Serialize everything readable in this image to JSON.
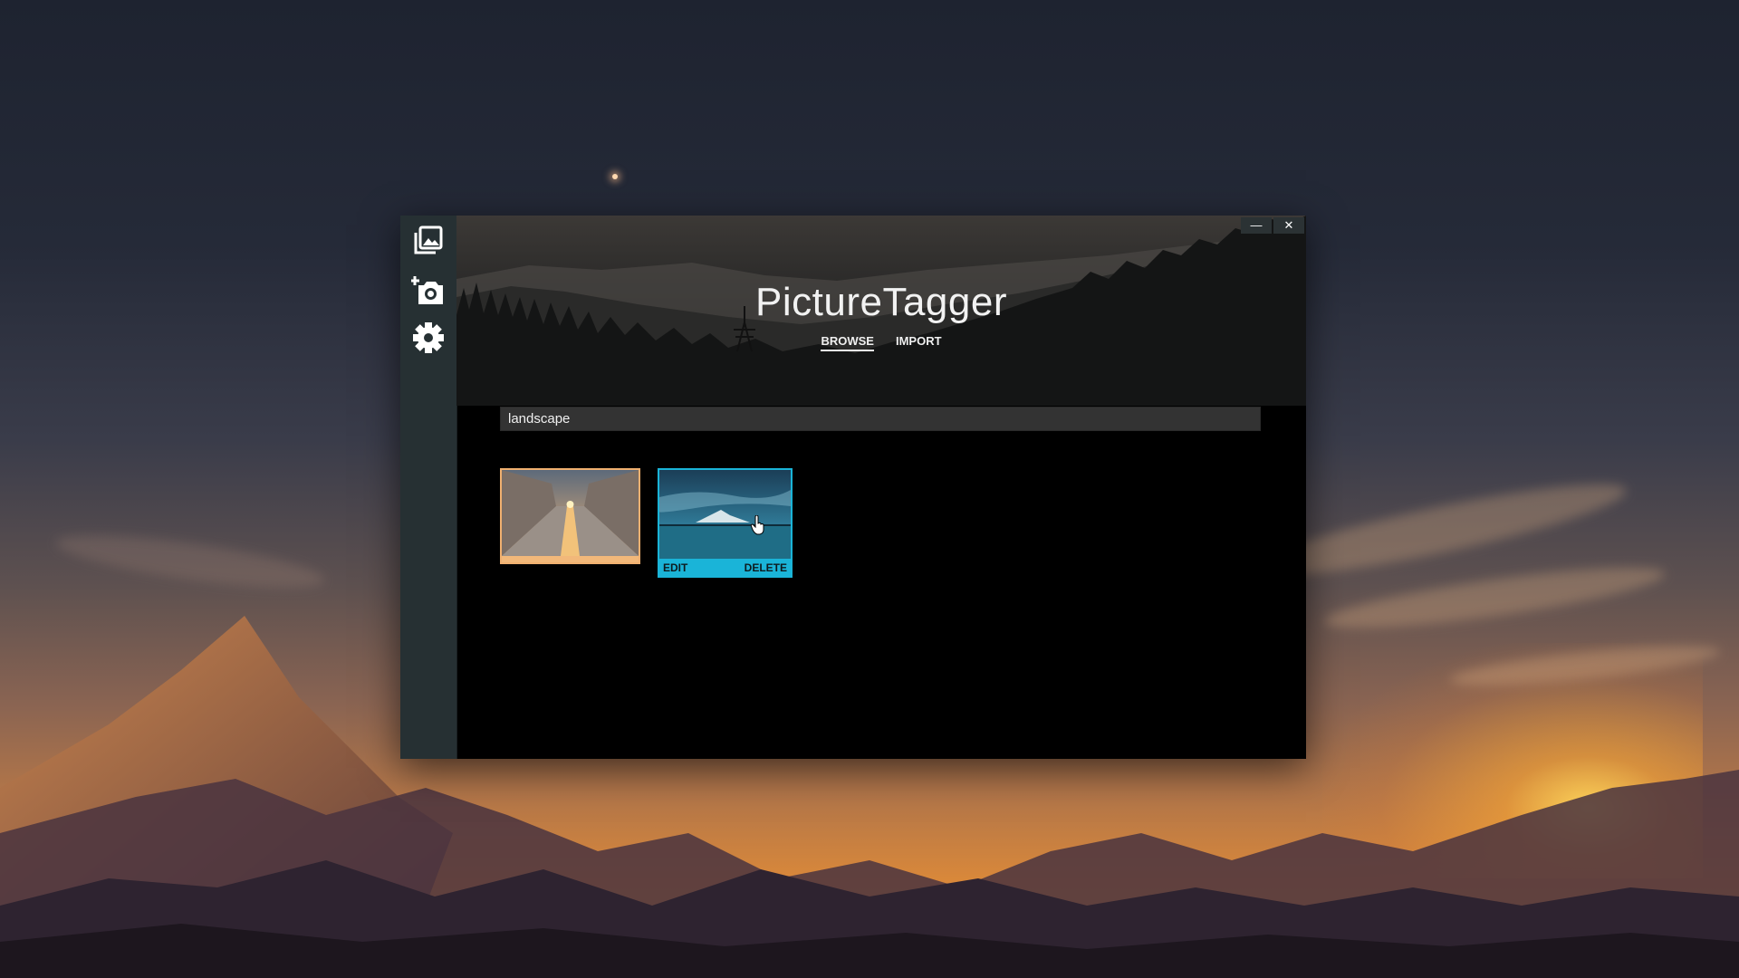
{
  "app": {
    "title": "PictureTagger"
  },
  "window_controls": {
    "minimize": "—",
    "close": "✕"
  },
  "tabs": [
    {
      "label": "BROWSE",
      "active": true
    },
    {
      "label": "IMPORT",
      "active": false
    }
  ],
  "sidebar": {
    "items": [
      {
        "icon": "photo-library-icon"
      },
      {
        "icon": "add-photo-icon"
      },
      {
        "icon": "gear-icon"
      }
    ]
  },
  "search": {
    "value": "landscape"
  },
  "thumbnails": [
    {
      "subject": "corridor at sunset",
      "accent": "#f0b070",
      "selected": false
    },
    {
      "subject": "mountain lake",
      "accent": "#1ab4d8",
      "hovered": true
    }
  ],
  "thumb_actions": {
    "edit": "EDIT",
    "delete": "DELETE"
  },
  "colors": {
    "sidebar": "#263033",
    "accent_orange": "#f0b070",
    "accent_cyan": "#1ab4d8"
  }
}
